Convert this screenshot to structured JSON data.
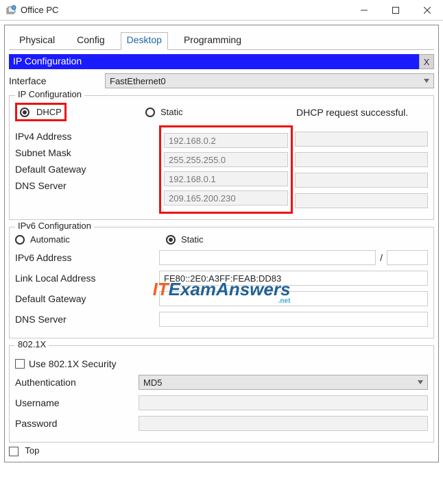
{
  "window": {
    "title": "Office PC"
  },
  "tabs": [
    "Physical",
    "Config",
    "Desktop",
    "Programming"
  ],
  "active_tab": 2,
  "panel": {
    "title": "IP Configuration",
    "close": "X"
  },
  "interface": {
    "label": "Interface",
    "value": "FastEthernet0"
  },
  "ipv4": {
    "legend": "IP Configuration",
    "dhcp": "DHCP",
    "static": "Static",
    "status": "DHCP request successful.",
    "fields": {
      "ipv4_addr_label": "IPv4 Address",
      "ipv4_addr": "192.168.0.2",
      "subnet_label": "Subnet Mask",
      "subnet": "255.255.255.0",
      "gateway_label": "Default Gateway",
      "gateway": "192.168.0.1",
      "dns_label": "DNS Server",
      "dns": "209.165.200.230"
    }
  },
  "ipv6": {
    "legend": "IPv6 Configuration",
    "auto": "Automatic",
    "static": "Static",
    "addr_label": "IPv6 Address",
    "addr": "",
    "prefix": "",
    "sep": "/",
    "link_local_label": "Link Local Address",
    "link_local": "FE80::2E0:A3FF:FEAB:DD83",
    "gateway_label": "Default Gateway",
    "gateway": "",
    "dns_label": "DNS Server",
    "dns": ""
  },
  "dot1x": {
    "legend": "802.1X",
    "use_label": "Use 802.1X Security",
    "auth_label": "Authentication",
    "auth_value": "MD5",
    "user_label": "Username",
    "user": "",
    "pass_label": "Password",
    "pass": ""
  },
  "bottom": {
    "top_label": "Top"
  },
  "watermark": {
    "it_i": "IT",
    "it_t": "",
    "rest": "ExamAnswers",
    "net": ".net"
  }
}
